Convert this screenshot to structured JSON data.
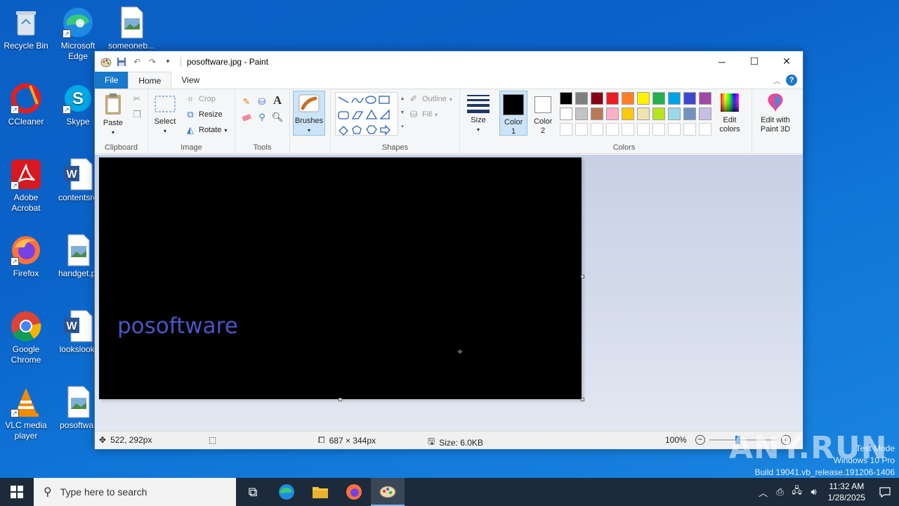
{
  "desktop": {
    "icons": [
      {
        "label": "Recycle Bin"
      },
      {
        "label": "Microsoft Edge"
      },
      {
        "label": "someoneb..."
      },
      {
        "label": "CCleaner"
      },
      {
        "label": "Skype"
      },
      {
        "label": "Adobe Acrobat"
      },
      {
        "label": "contentsre"
      },
      {
        "label": "Firefox"
      },
      {
        "label": "handget.pi"
      },
      {
        "label": "Google Chrome"
      },
      {
        "label": "lookslooki"
      },
      {
        "label": "VLC media player"
      },
      {
        "label": "posoftwar"
      }
    ]
  },
  "window": {
    "title": "posoftware.jpg - Paint",
    "tabs": [
      "File",
      "Home",
      "View"
    ],
    "ribbon": {
      "clipboard": {
        "paste": "Paste",
        "group": "Clipboard"
      },
      "image": {
        "select": "Select",
        "crop": "Crop",
        "resize": "Resize",
        "rotate": "Rotate",
        "group": "Image"
      },
      "tools": {
        "group": "Tools"
      },
      "brushes": "Brushes",
      "shapes": {
        "outline": "Outline",
        "fill": "Fill",
        "group": "Shapes"
      },
      "size": "Size",
      "color1": "Color 1",
      "color2": "Color 2",
      "colors_group": "Colors",
      "edit_colors": "Edit colors",
      "edit_paint3d": "Edit with Paint 3D"
    },
    "palette": [
      "#000000",
      "#7f7f7f",
      "#880015",
      "#ed1c24",
      "#ff7f27",
      "#fff200",
      "#22b14c",
      "#00a2e8",
      "#3f48cc",
      "#a349a4",
      "#ffffff",
      "#c3c3c3",
      "#b97a57",
      "#ffaec9",
      "#ffc90e",
      "#efe4b0",
      "#b5e61d",
      "#99d9ea",
      "#7092be",
      "#c8bfe7"
    ],
    "canvas_text": "posoftware",
    "status": {
      "cursor": "522, 292px",
      "dimensions": "687 × 344px",
      "size": "Size: 6.0KB",
      "zoom": "100%"
    }
  },
  "taskbar": {
    "search_placeholder": "Type here to search",
    "time": "11:32 AM",
    "date": "1/28/2025"
  },
  "watermark": {
    "line1": "Test Mode",
    "line2": "Windows 10 Pro",
    "line3": "Build 19041.vb_release.191206-1406",
    "brand": "ANY.RUN"
  }
}
